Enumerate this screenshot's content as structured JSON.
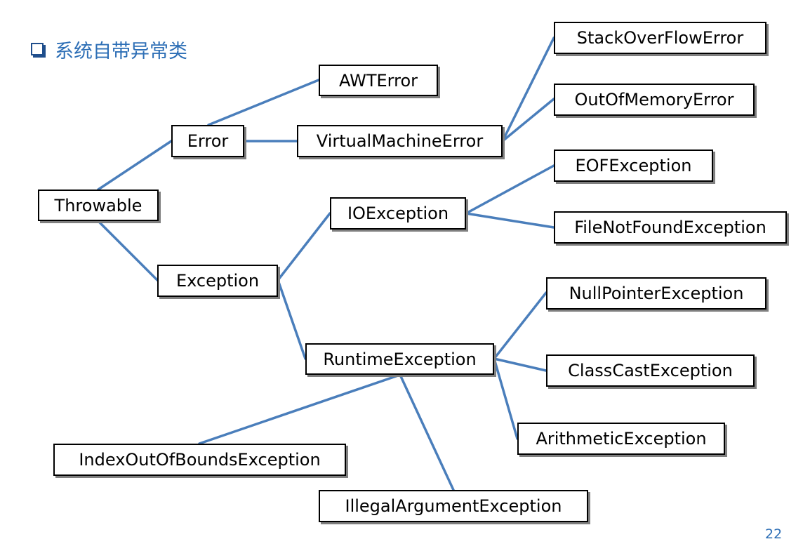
{
  "title": "系统自带异常类",
  "page_number": "22",
  "colors": {
    "title": "#2E6FB6",
    "connector": "#4A7EBB",
    "box_border": "#000000"
  },
  "nodes": {
    "throwable": "Throwable",
    "error": "Error",
    "exception": "Exception",
    "awterror": "AWTError",
    "virtualmachineerror": "VirtualMachineError",
    "stackoverflowerror": "StackOverFlowError",
    "outofmemoryerror": "OutOfMemoryError",
    "ioexception": "IOException",
    "eofexception": "EOFException",
    "filenotfoundexception": "FileNotFoundException",
    "runtimeexception": "RuntimeException",
    "nullpointerexception": "NullPointerException",
    "classcastexception": "ClassCastException",
    "arithmeticexception": "ArithmeticException",
    "indexoutofboundsexception": "IndexOutOfBoundsException",
    "illegalargumentexception": "IllegalArgumentException"
  }
}
